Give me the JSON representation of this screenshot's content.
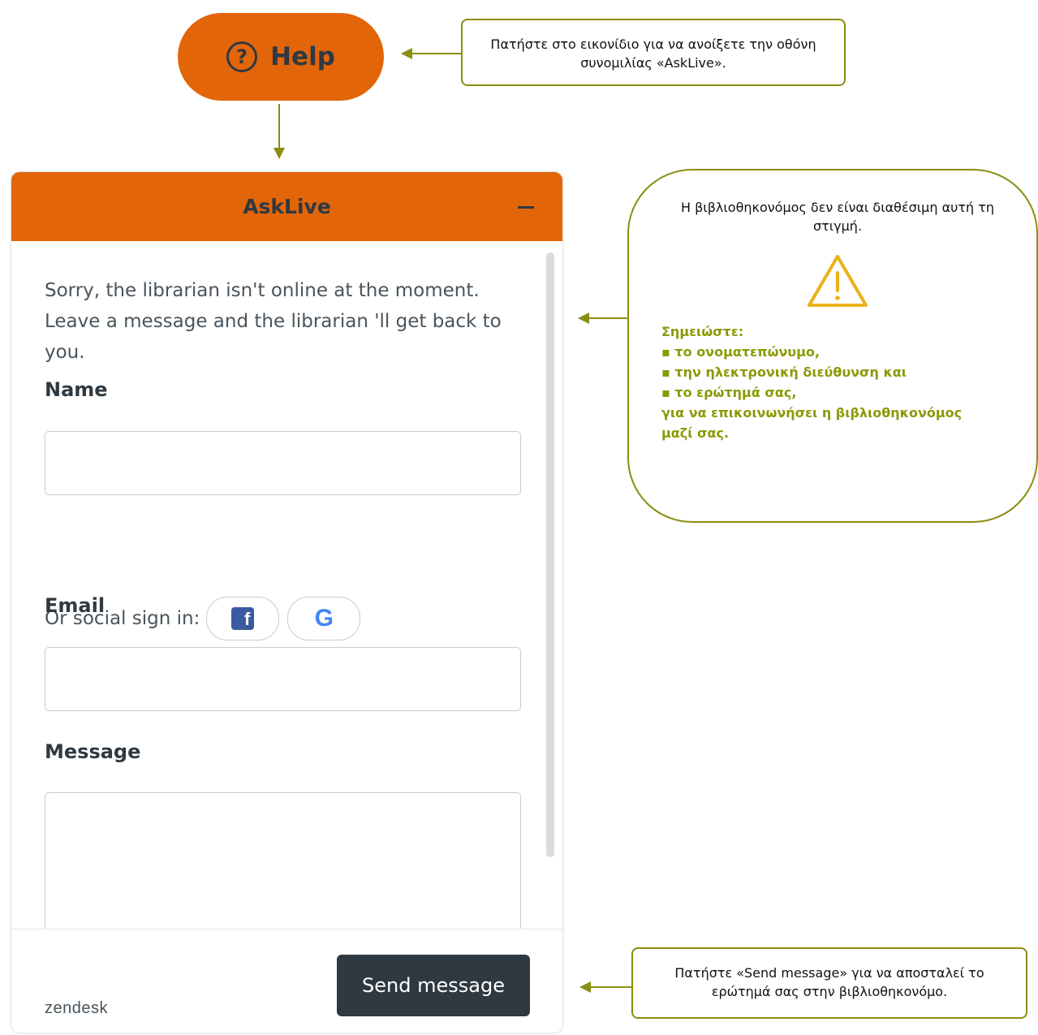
{
  "help_button": {
    "label": "Help",
    "icon": "question-circle-icon"
  },
  "callouts": {
    "help": "Πατήστε στο εικονίδιο για να ανοίξετε την οθόνη συνομιλίας «AskLive».",
    "offline_intro": "Η βιβλιοθηκονόμος δεν είναι διαθέσιμη αυτή τη στιγμή.",
    "offline_icon": "warning-triangle-icon",
    "notes": [
      "Σημειώστε:",
      "▪ το ονοματεπώνυμο,",
      "▪ την ηλεκτρονική διεύθυνση και",
      "▪ το ερώτημά σας,",
      "για να επικοινωνήσει η βιβλιοθηκονόμος",
      "μαζί σας."
    ],
    "send": "Πατήστε «Send message» για να αποσταλεί το ερώτημά σας στην βιβλιοθηκονόμο."
  },
  "colors": {
    "accent": "#e36509",
    "annotation": "#8a8e10",
    "note_text": "#8a9a05",
    "dark": "#2f3941"
  },
  "widget": {
    "title": "AskLive",
    "offline_message": "Sorry, the librarian isn't online at the moment. Leave a message and the librarian 'll get back to you.",
    "name_label": "Name",
    "name_value": "",
    "social_label": "Or social sign in:",
    "social_icons": [
      "facebook-icon",
      "google-icon"
    ],
    "email_label": "Email",
    "email_value": "",
    "message_label": "Message",
    "message_value": "",
    "send_label": "Send message",
    "brand": "zendesk"
  }
}
